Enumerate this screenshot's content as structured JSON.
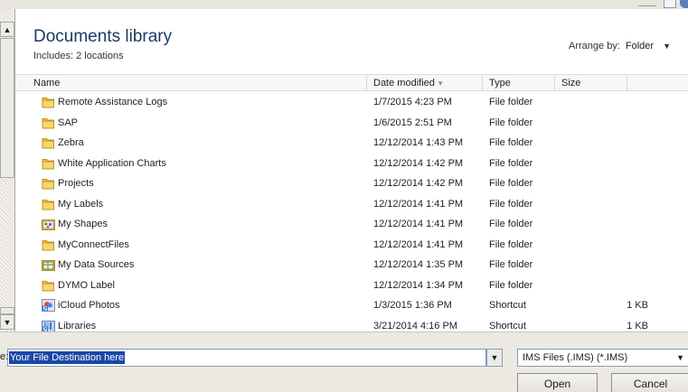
{
  "library": {
    "title": "Documents library",
    "subtitle": "Includes: 2 locations",
    "arrange_label": "Arrange by:",
    "arrange_value": "Folder"
  },
  "columns": {
    "name": "Name",
    "date": "Date modified",
    "type": "Type",
    "size": "Size"
  },
  "files": [
    {
      "name": "Remote Assistance Logs",
      "date": "1/7/2015 4:23 PM",
      "type": "File folder",
      "size": "",
      "icon": "folder-icon"
    },
    {
      "name": "SAP",
      "date": "1/6/2015 2:51 PM",
      "type": "File folder",
      "size": "",
      "icon": "folder-icon"
    },
    {
      "name": "Zebra",
      "date": "12/12/2014 1:43 PM",
      "type": "File folder",
      "size": "",
      "icon": "folder-icon"
    },
    {
      "name": "White Application Charts",
      "date": "12/12/2014 1:42 PM",
      "type": "File folder",
      "size": "",
      "icon": "folder-icon"
    },
    {
      "name": "Projects",
      "date": "12/12/2014 1:42 PM",
      "type": "File folder",
      "size": "",
      "icon": "folder-icon"
    },
    {
      "name": "My Labels",
      "date": "12/12/2014 1:41 PM",
      "type": "File folder",
      "size": "",
      "icon": "folder-icon"
    },
    {
      "name": "My Shapes",
      "date": "12/12/2014 1:41 PM",
      "type": "File folder",
      "size": "",
      "icon": "shapes-folder-icon"
    },
    {
      "name": "MyConnectFiles",
      "date": "12/12/2014 1:41 PM",
      "type": "File folder",
      "size": "",
      "icon": "folder-icon"
    },
    {
      "name": "My Data Sources",
      "date": "12/12/2014 1:35 PM",
      "type": "File folder",
      "size": "",
      "icon": "data-sources-icon"
    },
    {
      "name": "DYMO Label",
      "date": "12/12/2014 1:34 PM",
      "type": "File folder",
      "size": "",
      "icon": "folder-icon"
    },
    {
      "name": "iCloud Photos",
      "date": "1/3/2015 1:36 PM",
      "type": "Shortcut",
      "size": "1 KB",
      "icon": "icloud-shortcut-icon"
    },
    {
      "name": "Libraries",
      "date": "3/21/2014 4:16 PM",
      "type": "Shortcut",
      "size": "1 KB",
      "icon": "libraries-shortcut-icon"
    }
  ],
  "filename": {
    "label": "e:",
    "value": "Your File Destination here"
  },
  "filter": {
    "value": "IMS Files (.IMS) (*.IMS)"
  },
  "buttons": {
    "open": "Open",
    "cancel": "Cancel"
  },
  "colors": {
    "title": "#1c3a63",
    "selection": "#1a46a6",
    "folder": "#e8b93a"
  }
}
